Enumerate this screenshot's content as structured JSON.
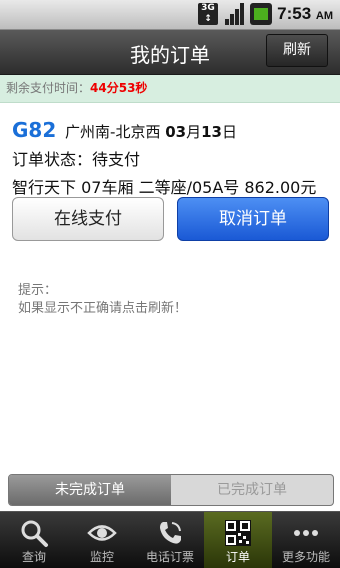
{
  "status_bar": {
    "network": "3G",
    "time": "7:53",
    "ampm": "AM"
  },
  "header": {
    "title": "我的订单",
    "refresh_label": "刷新"
  },
  "timer": {
    "label": "剩余支付时间：",
    "value": "44分53秒"
  },
  "order": {
    "train": "G82",
    "route": "广州南-北京西",
    "date_month": "03",
    "month_char": "月",
    "date_day": "13",
    "day_char": "日",
    "status_label": "订单状态：",
    "status_value": "待支付",
    "passenger": "智行天下",
    "car": "07车厢",
    "seat_class": "二等座/05A号",
    "price": "862.00元"
  },
  "actions": {
    "pay_label": "在线支付",
    "cancel_label": "取消订单"
  },
  "tips": {
    "title": "提示：",
    "text": "如果显示不正确请点击刷新！"
  },
  "segment": {
    "incomplete_label": "未完成订单",
    "complete_label": "已完成订单"
  },
  "tabs": [
    {
      "label": "查询",
      "icon": "search-icon"
    },
    {
      "label": "监控",
      "icon": "eye-icon"
    },
    {
      "label": "电话订票",
      "icon": "phone-icon"
    },
    {
      "label": "订单",
      "icon": "qr-code-icon",
      "active": true
    },
    {
      "label": "更多功能",
      "icon": "more-icon"
    }
  ],
  "colors": {
    "accent_blue": "#1a6fd8",
    "timer_red": "#e00000",
    "timer_bg": "#d7eee0",
    "active_tab": "#4b5a17"
  }
}
